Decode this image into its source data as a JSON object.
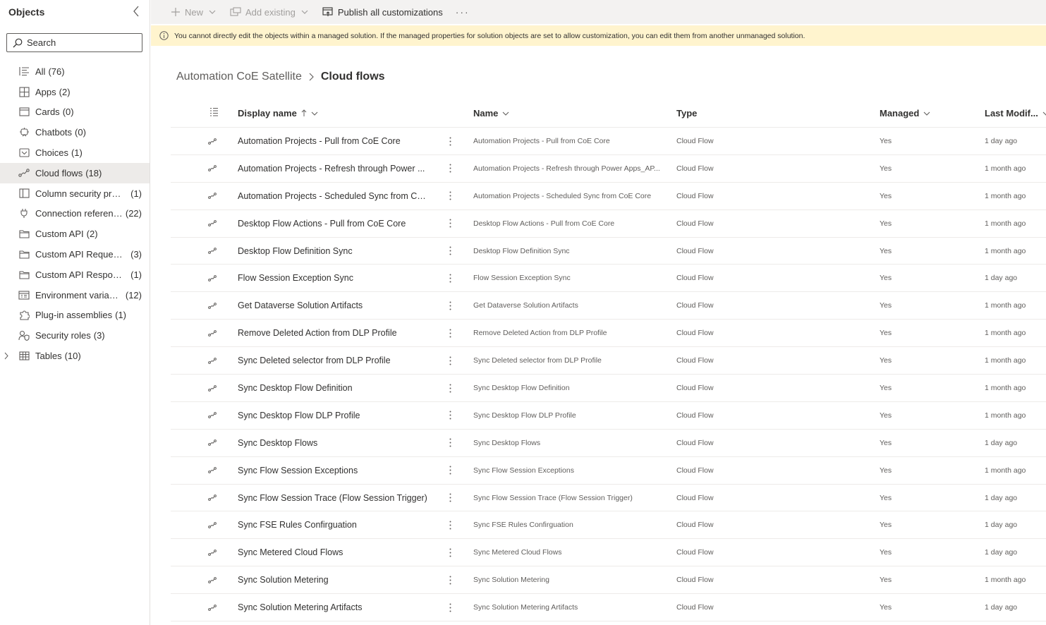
{
  "sidebar": {
    "title": "Objects",
    "search_placeholder": "Search",
    "items": [
      {
        "label": "All",
        "count": "(76)",
        "icon": "list-icon"
      },
      {
        "label": "Apps",
        "count": "(2)",
        "icon": "apps-icon"
      },
      {
        "label": "Cards",
        "count": "(0)",
        "icon": "card-icon"
      },
      {
        "label": "Chatbots",
        "count": "(0)",
        "icon": "chatbot-icon"
      },
      {
        "label": "Choices",
        "count": "(1)",
        "icon": "choice-icon"
      },
      {
        "label": "Cloud flows",
        "count": "(18)",
        "icon": "flow-icon"
      },
      {
        "label": "Column security profi...",
        "count": "(1)",
        "icon": "column-security-icon"
      },
      {
        "label": "Connection referenc...",
        "count": "(22)",
        "icon": "plug-icon"
      },
      {
        "label": "Custom API",
        "count": "(2)",
        "icon": "folder-icon"
      },
      {
        "label": "Custom API Request ...",
        "count": "(3)",
        "icon": "folder-icon"
      },
      {
        "label": "Custom API Response...",
        "count": "(1)",
        "icon": "folder-icon"
      },
      {
        "label": "Environment variables",
        "count": "(12)",
        "icon": "variable-icon"
      },
      {
        "label": "Plug-in assemblies",
        "count": "(1)",
        "icon": "puzzle-icon"
      },
      {
        "label": "Security roles",
        "count": "(3)",
        "icon": "security-role-icon"
      },
      {
        "label": "Tables",
        "count": "(10)",
        "icon": "table-icon"
      }
    ]
  },
  "commandbar": {
    "new_label": "New",
    "add_existing_label": "Add existing",
    "publish_label": "Publish all customizations",
    "more_label": "···"
  },
  "banner": {
    "message": "You cannot directly edit the objects within a managed solution. If the managed properties for solution objects are set to allow customization, you can edit them from another unmanaged solution."
  },
  "breadcrumb": {
    "parent": "Automation CoE Satellite",
    "current": "Cloud flows"
  },
  "grid": {
    "columns": {
      "display_name": "Display name",
      "name": "Name",
      "type": "Type",
      "managed": "Managed",
      "last_modified": "Last Modif..."
    },
    "rows": [
      {
        "display_name": "Automation Projects - Pull from CoE Core",
        "name": "Automation Projects - Pull from CoE Core",
        "type": "Cloud Flow",
        "managed": "Yes",
        "last_modified": "1 day ago"
      },
      {
        "display_name": "Automation Projects - Refresh through Power ...",
        "name": "Automation Projects - Refresh through Power Apps_AP...",
        "type": "Cloud Flow",
        "managed": "Yes",
        "last_modified": "1 month ago"
      },
      {
        "display_name": "Automation Projects - Scheduled Sync from Co...",
        "name": "Automation Projects - Scheduled Sync from CoE Core",
        "type": "Cloud Flow",
        "managed": "Yes",
        "last_modified": "1 month ago"
      },
      {
        "display_name": "Desktop Flow Actions - Pull from CoE Core",
        "name": "Desktop Flow Actions - Pull from CoE Core",
        "type": "Cloud Flow",
        "managed": "Yes",
        "last_modified": "1 month ago"
      },
      {
        "display_name": "Desktop Flow Definition Sync",
        "name": "Desktop Flow Definition Sync",
        "type": "Cloud Flow",
        "managed": "Yes",
        "last_modified": "1 month ago"
      },
      {
        "display_name": "Flow Session Exception Sync",
        "name": "Flow Session Exception Sync",
        "type": "Cloud Flow",
        "managed": "Yes",
        "last_modified": "1 day ago"
      },
      {
        "display_name": "Get Dataverse Solution Artifacts",
        "name": "Get Dataverse Solution Artifacts",
        "type": "Cloud Flow",
        "managed": "Yes",
        "last_modified": "1 month ago"
      },
      {
        "display_name": "Remove Deleted Action from DLP Profile",
        "name": "Remove Deleted Action from DLP Profile",
        "type": "Cloud Flow",
        "managed": "Yes",
        "last_modified": "1 month ago"
      },
      {
        "display_name": "Sync Deleted selector from DLP Profile",
        "name": "Sync Deleted selector from DLP Profile",
        "type": "Cloud Flow",
        "managed": "Yes",
        "last_modified": "1 month ago"
      },
      {
        "display_name": "Sync Desktop Flow Definition",
        "name": "Sync Desktop Flow Definition",
        "type": "Cloud Flow",
        "managed": "Yes",
        "last_modified": "1 month ago"
      },
      {
        "display_name": "Sync Desktop Flow DLP Profile",
        "name": "Sync Desktop Flow DLP Profile",
        "type": "Cloud Flow",
        "managed": "Yes",
        "last_modified": "1 month ago"
      },
      {
        "display_name": "Sync Desktop Flows",
        "name": "Sync Desktop Flows",
        "type": "Cloud Flow",
        "managed": "Yes",
        "last_modified": "1 day ago"
      },
      {
        "display_name": "Sync Flow Session Exceptions",
        "name": "Sync Flow Session Exceptions",
        "type": "Cloud Flow",
        "managed": "Yes",
        "last_modified": "1 month ago"
      },
      {
        "display_name": "Sync Flow Session Trace (Flow Session Trigger)",
        "name": "Sync Flow Session Trace (Flow Session Trigger)",
        "type": "Cloud Flow",
        "managed": "Yes",
        "last_modified": "1 day ago"
      },
      {
        "display_name": "Sync FSE Rules Confirguation",
        "name": "Sync FSE Rules Confirguation",
        "type": "Cloud Flow",
        "managed": "Yes",
        "last_modified": "1 day ago"
      },
      {
        "display_name": "Sync Metered Cloud Flows",
        "name": "Sync Metered Cloud Flows",
        "type": "Cloud Flow",
        "managed": "Yes",
        "last_modified": "1 day ago"
      },
      {
        "display_name": "Sync Solution Metering",
        "name": "Sync Solution Metering",
        "type": "Cloud Flow",
        "managed": "Yes",
        "last_modified": "1 month ago"
      },
      {
        "display_name": "Sync Solution Metering Artifacts",
        "name": "Sync Solution Metering Artifacts",
        "type": "Cloud Flow",
        "managed": "Yes",
        "last_modified": "1 day ago"
      }
    ]
  }
}
